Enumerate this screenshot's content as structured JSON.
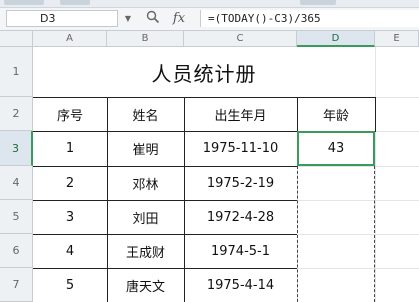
{
  "formula_bar": {
    "cell_ref": "D3",
    "dropdown_icon": "chevron-down-icon",
    "zoom_icon": "magnifier-icon",
    "fx_label": "fx",
    "formula": "=(TODAY()-C3)/365"
  },
  "columns": [
    "A",
    "B",
    "C",
    "D",
    "E"
  ],
  "active_column": "D",
  "rows": [
    "1",
    "2",
    "3",
    "4",
    "5",
    "6",
    "7"
  ],
  "active_row": "3",
  "sheet": {
    "title": "人员统计册",
    "headers": {
      "seq": "序号",
      "name": "姓名",
      "birth": "出生年月",
      "age": "年龄"
    },
    "data_rows": [
      {
        "seq": "1",
        "name": "崔明",
        "birth": "1975-11-10",
        "age": "43"
      },
      {
        "seq": "2",
        "name": "邓林",
        "birth": "1975-2-19",
        "age": ""
      },
      {
        "seq": "3",
        "name": "刘田",
        "birth": "1972-4-28",
        "age": ""
      },
      {
        "seq": "4",
        "name": "王成财",
        "birth": "1974-5-1",
        "age": ""
      },
      {
        "seq": "5",
        "name": "唐天文",
        "birth": "1975-4-14",
        "age": ""
      }
    ]
  },
  "colors": {
    "selection": "#3a9a5a",
    "header_bg": "#eef1f4"
  }
}
